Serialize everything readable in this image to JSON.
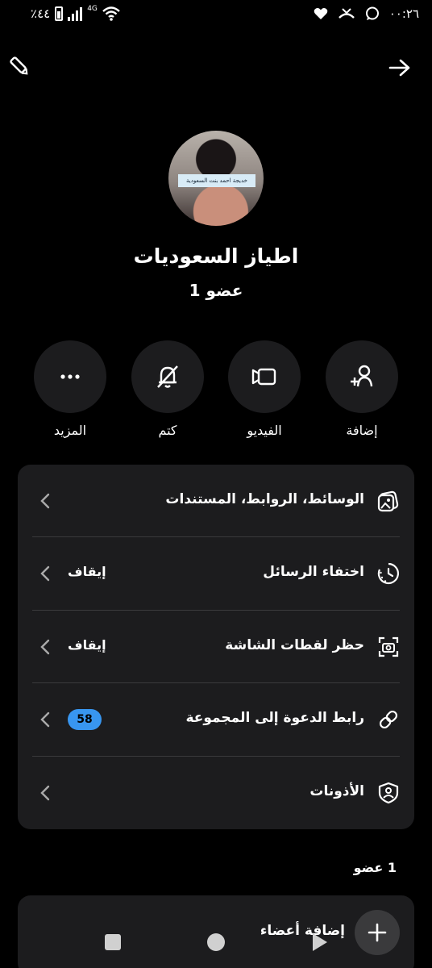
{
  "status_bar": {
    "time": "٠٠:٢٦",
    "battery": "٪٤٤",
    "network": "4G",
    "icons": [
      "chat-bubble-icon",
      "missed-call-icon",
      "heart-icon",
      "wifi-icon",
      "signal-icon",
      "battery-icon"
    ]
  },
  "top_bar": {
    "back_icon": "arrow-right-icon",
    "edit_icon": "pencil-icon"
  },
  "group": {
    "avatar_caption": "خديجة احمد بنت السعودية",
    "name": "اطياز السعوديات",
    "member_count": "1 عضو"
  },
  "actions": [
    {
      "label": "إضافة",
      "icon": "add-person-icon"
    },
    {
      "label": "الفيديو",
      "icon": "video-icon"
    },
    {
      "label": "كتم",
      "icon": "bell-off-icon"
    },
    {
      "label": "المزيد",
      "icon": "more-icon"
    }
  ],
  "settings": [
    {
      "label": "الوسائط، الروابط، المستندات",
      "value": "",
      "icon": "media-icon"
    },
    {
      "label": "اختفاء الرسائل",
      "value": "إيقاف",
      "icon": "timer-icon"
    },
    {
      "label": "حظر لقطات الشاشة",
      "value": "إيقاف",
      "icon": "screenshot-icon"
    },
    {
      "label": "رابط الدعوة إلى المجموعة",
      "badge": "58",
      "icon": "link-icon"
    },
    {
      "label": "الأذونات",
      "value": "",
      "icon": "permissions-icon"
    }
  ],
  "members": {
    "header": "1 عضو",
    "add_label": "إضافة أعضاء"
  },
  "colors": {
    "background": "#000000",
    "card": "#1c1c1e",
    "badge": "#3896f0"
  },
  "nav_bar": {
    "icons": [
      "recents-square-icon",
      "home-circle-icon",
      "back-triangle-icon"
    ]
  }
}
